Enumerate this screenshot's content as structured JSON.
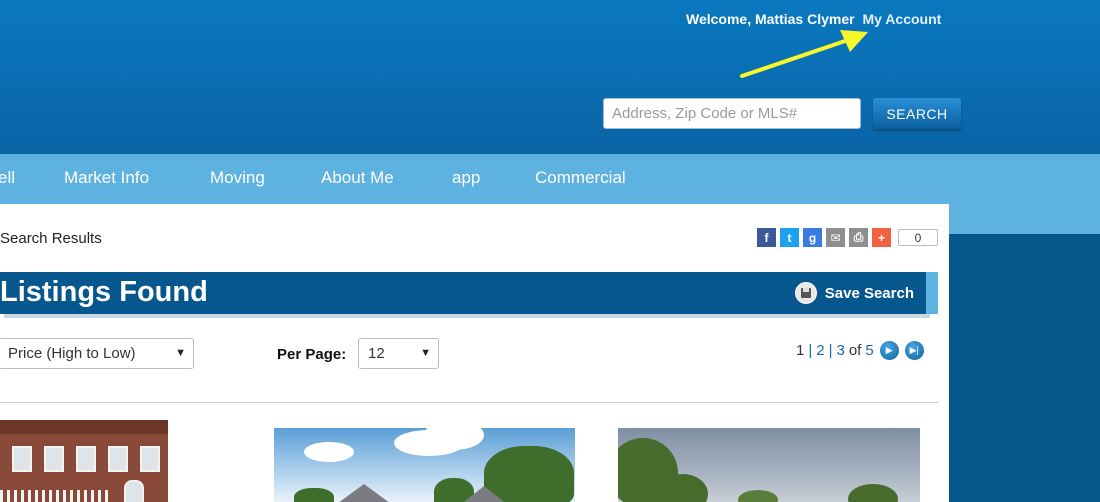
{
  "header": {
    "welcome_text": "Welcome, Mattias Clymer",
    "my_account": "My Account",
    "search_placeholder": "Address, Zip Code or MLS#",
    "search_button": "SEARCH",
    "annotation_arrow_color": "#f7f72a"
  },
  "nav": {
    "items": [
      "ell",
      "Market Info",
      "Moving",
      "About Me",
      "app",
      "Commercial"
    ]
  },
  "results": {
    "breadcrumb": "Search Results",
    "share": {
      "icons": [
        "facebook-icon",
        "twitter-icon",
        "google-plus-icon",
        "email-icon",
        "print-icon",
        "add-share-icon"
      ],
      "count": "0"
    },
    "title": "Listings Found",
    "save_search": "Save Search",
    "sort": {
      "value": "Price (High to Low)"
    },
    "per_page": {
      "label": "Per Page:",
      "value": "12"
    },
    "pagination": {
      "current": "1",
      "pages": [
        "2",
        "3"
      ],
      "of_text": "of",
      "total": "5"
    }
  },
  "colors": {
    "header_blue": "#0a70b4",
    "nav_light_blue": "#5eb2e0",
    "banner_blue": "#07578f",
    "page_dark_blue": "#05578b"
  }
}
